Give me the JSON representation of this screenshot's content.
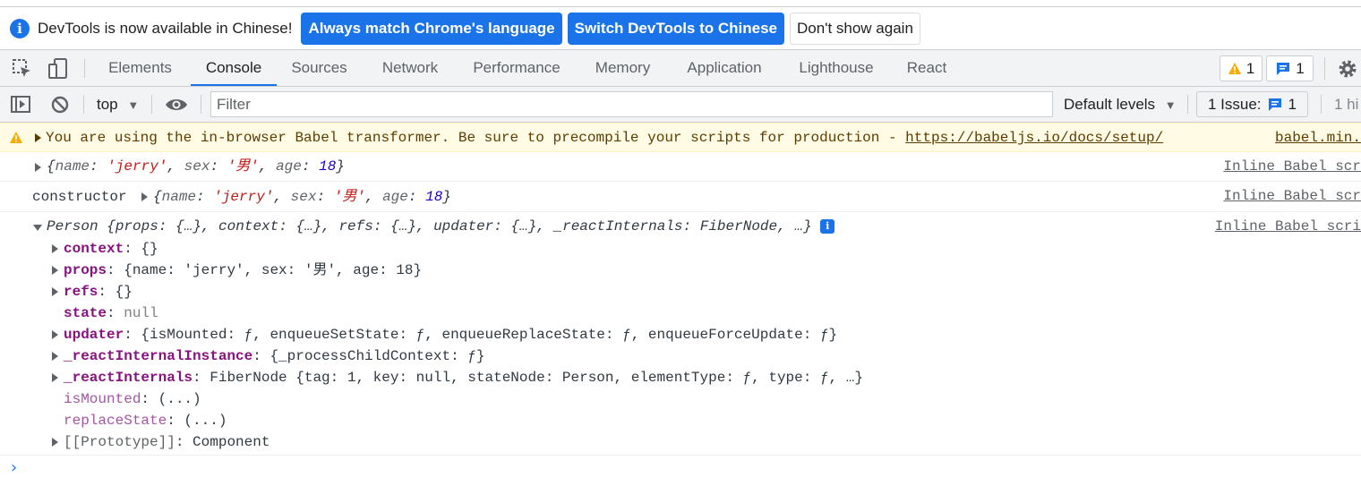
{
  "infobar": {
    "message": "DevTools is now available in Chinese!",
    "btn_match": "Always match Chrome's language",
    "btn_switch": "Switch DevTools to Chinese",
    "btn_dismiss": "Don't show again"
  },
  "tabs": [
    "Elements",
    "Console",
    "Sources",
    "Network",
    "Performance",
    "Memory",
    "Application",
    "Lighthouse",
    "React"
  ],
  "active_tab": "Console",
  "counters": {
    "warnings": "1",
    "messages": "1"
  },
  "toolbar": {
    "context": "top",
    "filter_placeholder": "Filter",
    "levels": "Default levels",
    "issues_label": "1 Issue:",
    "issues_count": "1",
    "hidden": "1 hi"
  },
  "colors": {
    "accent": "#1a73e8",
    "warning_bg": "#fffbe5",
    "warning_icon": "#f9ab00"
  },
  "console": {
    "warning": {
      "text": "You are using the in-browser Babel transformer. Be sure to precompile your scripts for production - ",
      "link": "https://babeljs.io/docs/setup/",
      "source": "babel.min."
    },
    "log1": {
      "obj": [
        "{",
        "name",
        ": ",
        "'jerry'",
        ", ",
        "sex",
        ": ",
        "'男'",
        ", ",
        "age",
        ": ",
        "18",
        "}"
      ],
      "source": "Inline Babel scr"
    },
    "log2": {
      "prefix": "constructor",
      "obj": [
        "{",
        "name",
        ": ",
        "'jerry'",
        ", ",
        "sex",
        ": ",
        "'男'",
        ", ",
        "age",
        ": ",
        "18",
        "}"
      ],
      "source": "Inline Babel scr"
    },
    "log3": {
      "header": "Person {props: {…}, context: {…}, refs: {…}, updater: {…}, _reactInternals: FiberNode, …}",
      "source": "Inline Babel scri",
      "props": [
        {
          "key": "context",
          "value": "{}",
          "expandable": true
        },
        {
          "key": "props",
          "value": "{name: 'jerry', sex: '男', age: 18}",
          "expandable": true
        },
        {
          "key": "refs",
          "value": "{}",
          "expandable": true
        },
        {
          "key": "state",
          "value": "null",
          "expandable": false
        },
        {
          "key": "updater",
          "value": "{isMounted: ƒ, enqueueSetState: ƒ, enqueueReplaceState: ƒ, enqueueForceUpdate: ƒ}",
          "expandable": true
        },
        {
          "key": "_reactInternalInstance",
          "value": "{_processChildContext: ƒ}",
          "expandable": true
        },
        {
          "key": "_reactInternals",
          "value": "FiberNode {tag: 1, key: null, stateNode: Person, elementType: ƒ, type: ƒ, …}",
          "expandable": true
        },
        {
          "key": "isMounted",
          "value": "(...)",
          "expandable": false,
          "accessor": true
        },
        {
          "key": "replaceState",
          "value": "(...)",
          "expandable": false,
          "accessor": true
        },
        {
          "key": "[[Prototype]]",
          "value": "Component",
          "expandable": true,
          "proto": true
        }
      ]
    },
    "prompt": "›"
  }
}
